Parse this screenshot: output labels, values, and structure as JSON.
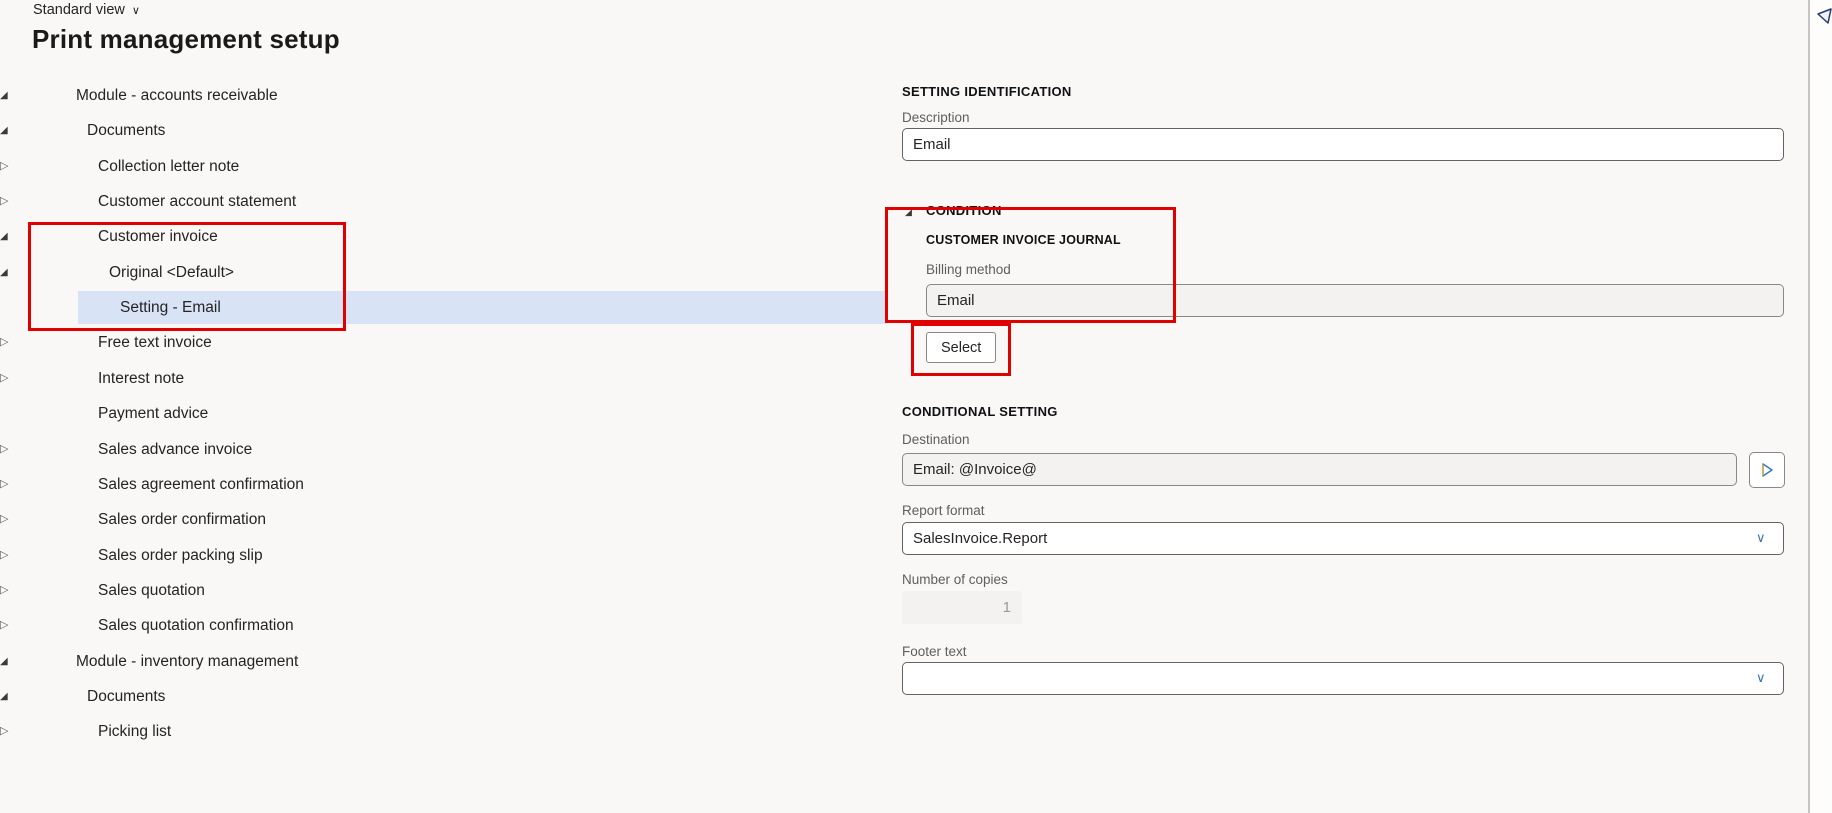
{
  "view_selector": {
    "label": "Standard view"
  },
  "page_title": "Print management setup",
  "tree": {
    "items": [
      {
        "label": "Module - accounts receivable",
        "level": 0,
        "state": "expanded",
        "selected": false
      },
      {
        "label": "Documents",
        "level": 1,
        "state": "expanded",
        "selected": false
      },
      {
        "label": "Collection letter note",
        "level": 2,
        "state": "collapsed",
        "selected": false
      },
      {
        "label": "Customer account statement",
        "level": 2,
        "state": "collapsed",
        "selected": false
      },
      {
        "label": "Customer invoice",
        "level": 2,
        "state": "expanded",
        "selected": false
      },
      {
        "label": "Original <Default>",
        "level": 3,
        "state": "expanded",
        "selected": false
      },
      {
        "label": "Setting - Email",
        "level": 4,
        "state": "none",
        "selected": true
      },
      {
        "label": "Free text invoice",
        "level": 2,
        "state": "collapsed",
        "selected": false
      },
      {
        "label": "Interest note",
        "level": 2,
        "state": "collapsed",
        "selected": false
      },
      {
        "label": "Payment advice",
        "level": 2,
        "state": "none",
        "selected": false
      },
      {
        "label": "Sales advance invoice",
        "level": 2,
        "state": "collapsed",
        "selected": false
      },
      {
        "label": "Sales agreement confirmation",
        "level": 2,
        "state": "collapsed",
        "selected": false
      },
      {
        "label": "Sales order confirmation",
        "level": 2,
        "state": "collapsed",
        "selected": false
      },
      {
        "label": "Sales order packing slip",
        "level": 2,
        "state": "collapsed",
        "selected": false
      },
      {
        "label": "Sales quotation",
        "level": 2,
        "state": "collapsed",
        "selected": false
      },
      {
        "label": "Sales quotation confirmation",
        "level": 2,
        "state": "collapsed",
        "selected": false
      },
      {
        "label": "Module - inventory management",
        "level": 0,
        "state": "expanded",
        "selected": false
      },
      {
        "label": "Documents",
        "level": 1,
        "state": "expanded",
        "selected": false
      },
      {
        "label": "Picking list",
        "level": 2,
        "state": "collapsed",
        "selected": false
      }
    ]
  },
  "form": {
    "setting_identification": {
      "header": "SETTING IDENTIFICATION",
      "description_label": "Description",
      "description_value": "Email"
    },
    "condition": {
      "header": "CONDITION",
      "journal_header": "CUSTOMER INVOICE JOURNAL",
      "billing_method_label": "Billing method",
      "billing_method_value": "Email",
      "select_button_label": "Select"
    },
    "conditional_setting": {
      "header": "CONDITIONAL SETTING",
      "destination_label": "Destination",
      "destination_value": "Email: @Invoice@",
      "report_format_label": "Report format",
      "report_format_value": "SalesInvoice.Report",
      "copies_label": "Number of copies",
      "copies_value": "1",
      "footer_label": "Footer text",
      "footer_value": ""
    }
  },
  "icons": {
    "view_chevron": "∨",
    "combo_chevron": "∨",
    "expanded_glyph": "◢",
    "collapsed_glyph": "▷"
  },
  "colors": {
    "annotation_red": "#e10000",
    "selection_blue": "#d8e4f6",
    "accent_blue": "#3575b5",
    "disabled_gray": "#f3f2f1"
  }
}
